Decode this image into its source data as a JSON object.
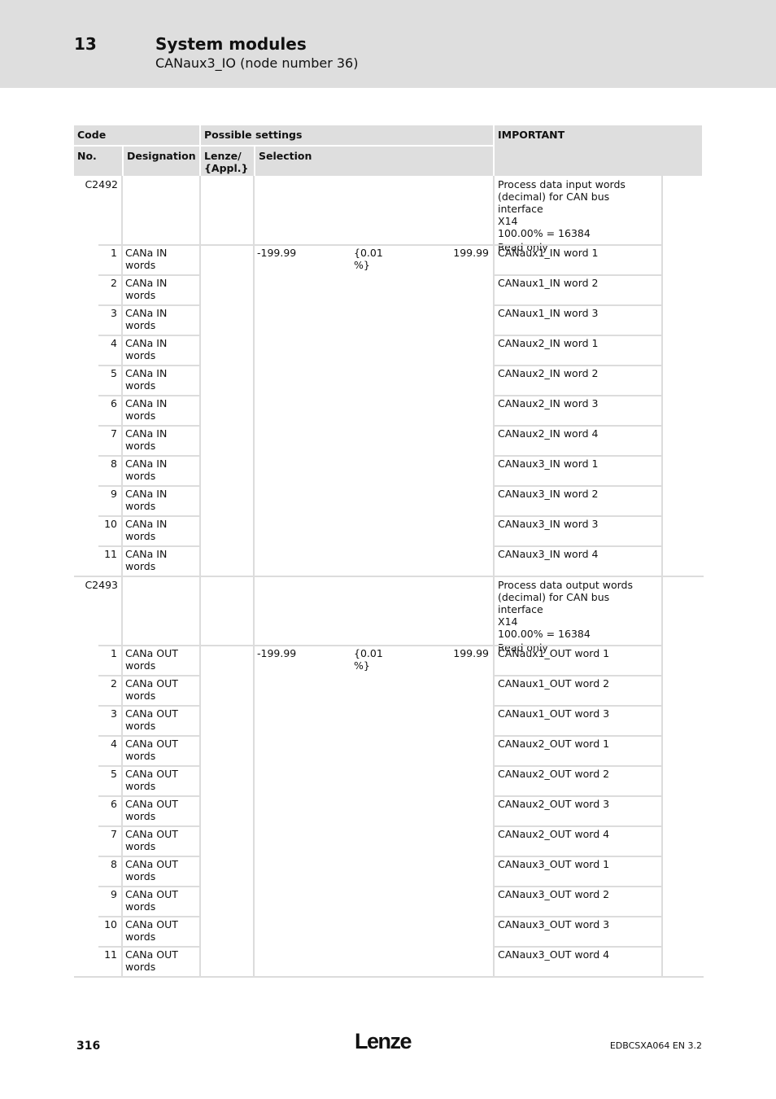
{
  "header": {
    "chapter_number": "13",
    "chapter_title": "System modules",
    "subtitle": "CANaux3_IO (node number 36)"
  },
  "table": {
    "headers": {
      "code": "Code",
      "possible_settings": "Possible settings",
      "important": "IMPORTANT",
      "no": "No.",
      "designation": "Designation",
      "lenze_appl": "Lenze/\n{Appl.}",
      "selection": "Selection"
    },
    "groups": [
      {
        "code": "C2492",
        "description": [
          "Process data input words",
          "(decimal) for CAN bus interface",
          "X14",
          "100.00% = 16384",
          "Read only"
        ],
        "selection": {
          "min": "-199.99",
          "step": "{0.01 %}",
          "max": "199.99"
        },
        "rows": [
          {
            "no": "1",
            "designation": "CANa IN words",
            "important": "CANaux1_IN word 1"
          },
          {
            "no": "2",
            "designation": "CANa IN words",
            "important": "CANaux1_IN word 2"
          },
          {
            "no": "3",
            "designation": "CANa IN words",
            "important": "CANaux1_IN word 3"
          },
          {
            "no": "4",
            "designation": "CANa IN words",
            "important": "CANaux2_IN word 1"
          },
          {
            "no": "5",
            "designation": "CANa IN words",
            "important": "CANaux2_IN word 2"
          },
          {
            "no": "6",
            "designation": "CANa IN words",
            "important": "CANaux2_IN word 3"
          },
          {
            "no": "7",
            "designation": "CANa IN words",
            "important": "CANaux2_IN word 4"
          },
          {
            "no": "8",
            "designation": "CANa IN words",
            "important": "CANaux3_IN word 1"
          },
          {
            "no": "9",
            "designation": "CANa IN words",
            "important": "CANaux3_IN word 2"
          },
          {
            "no": "10",
            "designation": "CANa IN words",
            "important": "CANaux3_IN word 3"
          },
          {
            "no": "11",
            "designation": "CANa IN words",
            "important": "CANaux3_IN word 4"
          }
        ]
      },
      {
        "code": "C2493",
        "description": [
          "Process data output words",
          "(decimal) for CAN bus interface",
          "X14",
          "100.00% = 16384",
          "Read only"
        ],
        "selection": {
          "min": "-199.99",
          "step": "{0.01 %}",
          "max": "199.99"
        },
        "rows": [
          {
            "no": "1",
            "designation": "CANa OUT words",
            "important": "CANaux1_OUT word 1"
          },
          {
            "no": "2",
            "designation": "CANa OUT words",
            "important": "CANaux1_OUT word 2"
          },
          {
            "no": "3",
            "designation": "CANa OUT words",
            "important": "CANaux1_OUT word 3"
          },
          {
            "no": "4",
            "designation": "CANa OUT words",
            "important": "CANaux2_OUT word 1"
          },
          {
            "no": "5",
            "designation": "CANa OUT words",
            "important": "CANaux2_OUT word 2"
          },
          {
            "no": "6",
            "designation": "CANa OUT words",
            "important": "CANaux2_OUT word 3"
          },
          {
            "no": "7",
            "designation": "CANa OUT words",
            "important": "CANaux2_OUT word 4"
          },
          {
            "no": "8",
            "designation": "CANa OUT words",
            "important": "CANaux3_OUT word 1"
          },
          {
            "no": "9",
            "designation": "CANa OUT words",
            "important": "CANaux3_OUT word 2"
          },
          {
            "no": "10",
            "designation": "CANa OUT words",
            "important": "CANaux3_OUT word 3"
          },
          {
            "no": "11",
            "designation": "CANa OUT words",
            "important": "CANaux3_OUT word 4"
          }
        ]
      }
    ]
  },
  "footer": {
    "page_number": "316",
    "logo": "Lenze",
    "doc_id": "EDBCSXA064  EN  3.2"
  }
}
